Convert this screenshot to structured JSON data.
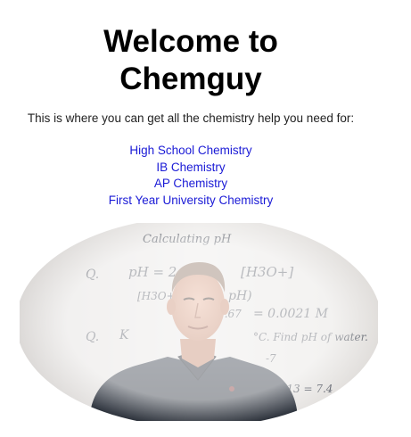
{
  "heading": {
    "line1": "Welcome to",
    "line2": "Chemguy"
  },
  "intro": "This is where you can get all the chemistry help you need for:",
  "links": [
    {
      "label": "High School Chemistry"
    },
    {
      "label": "IB Chemistry"
    },
    {
      "label": "AP Chemistry"
    },
    {
      "label": "First Year University Chemistry"
    }
  ],
  "colors": {
    "link": "#1a1ad6",
    "text": "#222222",
    "heading": "#000000"
  },
  "photo": {
    "board_text": {
      "top": "Calculating pH",
      "line1": "pH = 2.",
      "line1b": "[H3O+]",
      "q1": "Q.",
      "line2": "[H3O+]",
      "line2b": "pH)",
      "line3": "-2.67",
      "line3b": "= 0.0021 M",
      "q2": "Q.",
      "line4a": "K",
      "line4": "°C. Find pH of water.",
      "line5": "-7",
      "line6": "10^-13 = 7.4"
    }
  }
}
